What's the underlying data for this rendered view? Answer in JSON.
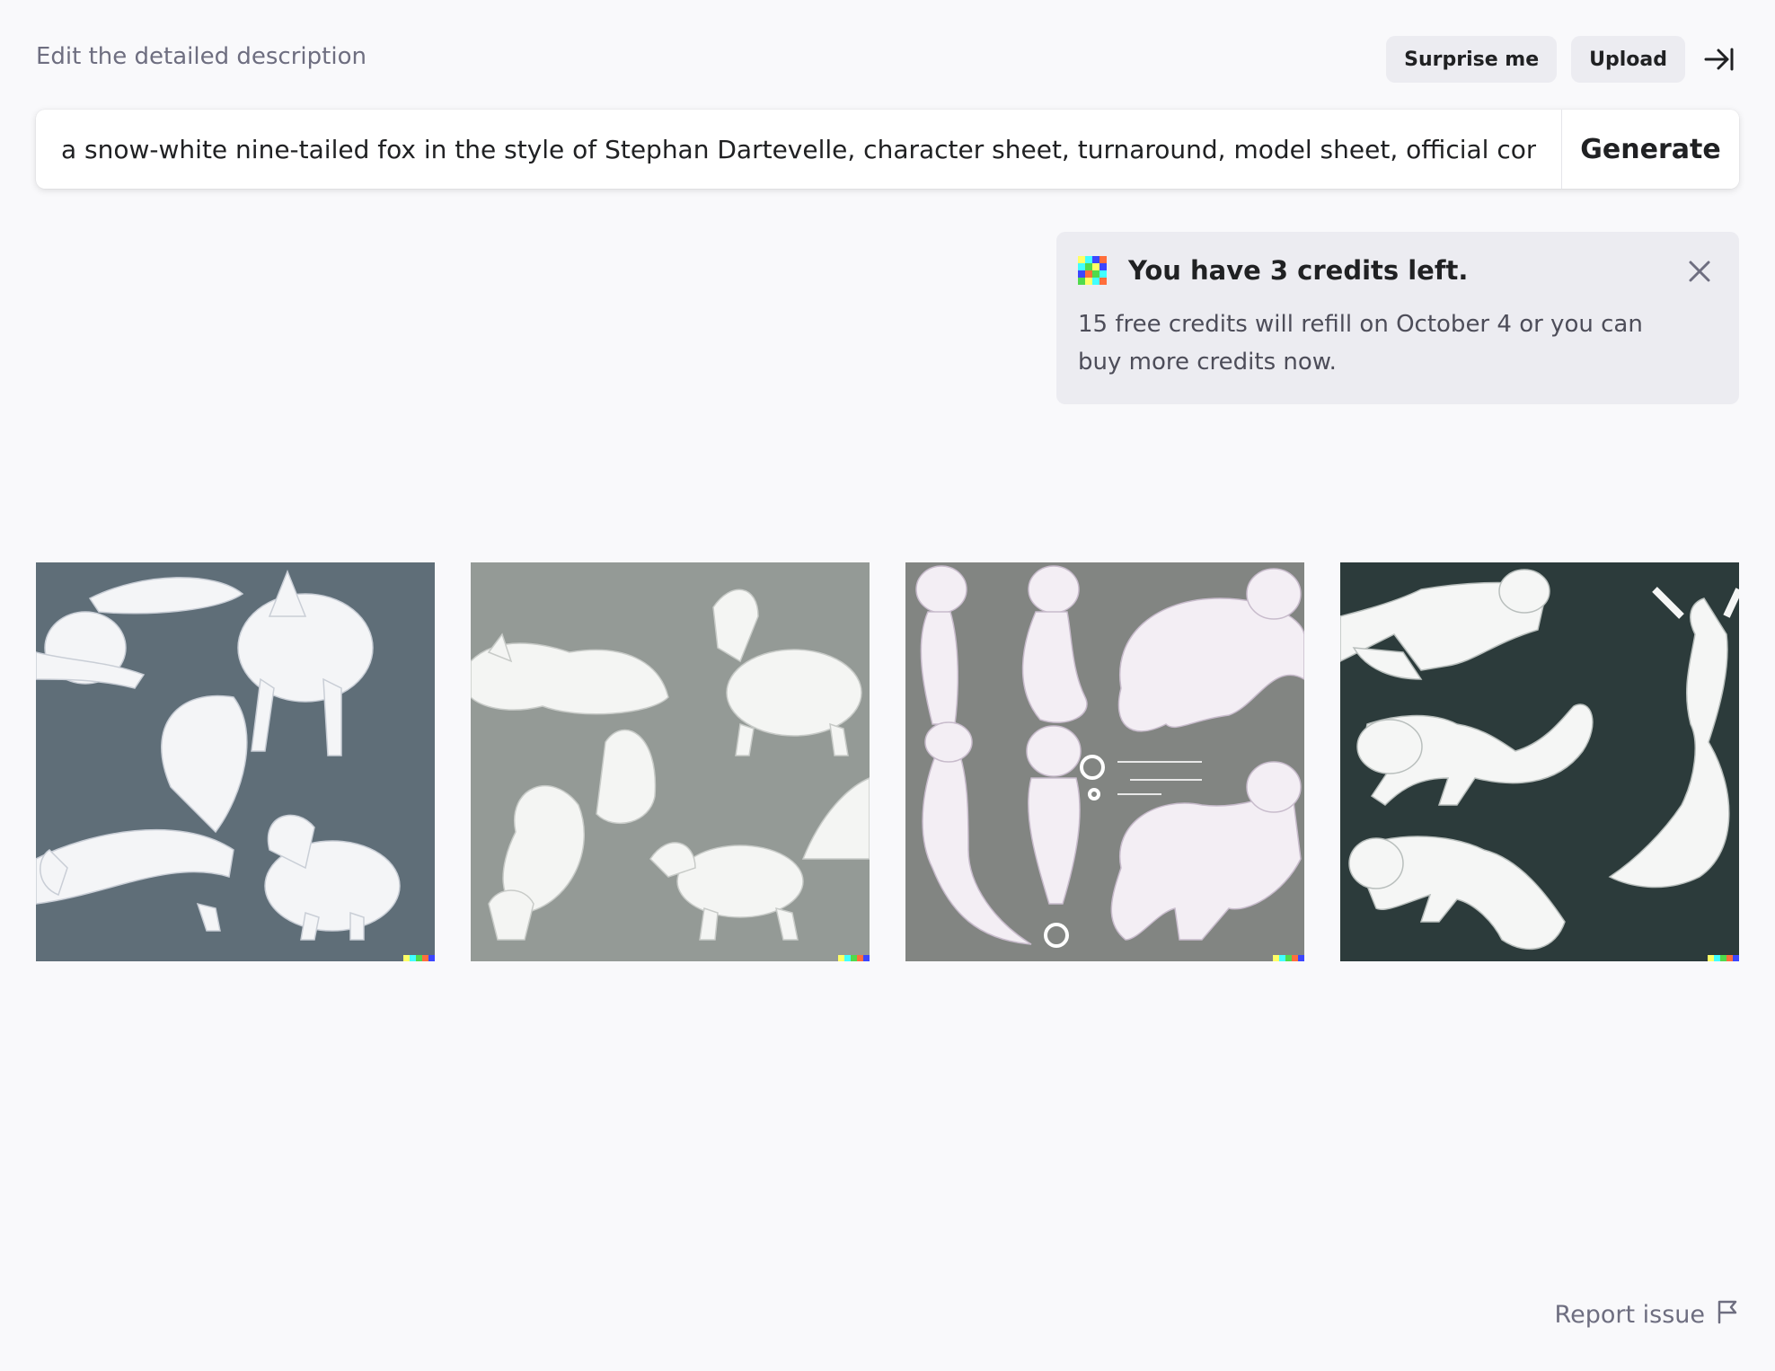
{
  "header": {
    "instruction": "Edit the detailed description",
    "surprise_label": "Surprise me",
    "upload_label": "Upload",
    "collapse_icon": "collapse-right-icon"
  },
  "prompt": {
    "value": "a snow-white nine-tailed fox in the style of Stephan Dartevelle, character sheet, turnaround, model sheet, official conce",
    "generate_label": "Generate"
  },
  "credits_banner": {
    "title": "You have 3 credits left.",
    "body": "15 free credits will refill on October 4 or you can buy more credits now.",
    "logo_colors": [
      "#ffff66",
      "#42ffff",
      "#51da4c",
      "#ff6e3c",
      "#3c46ff"
    ],
    "close_icon": "close-icon"
  },
  "gallery": {
    "images": [
      {
        "background": "#5f6e78",
        "subject": "white fox poses"
      },
      {
        "background": "#949a96",
        "subject": "white fox poses"
      },
      {
        "background": "#828582",
        "subject": "white fox poses"
      },
      {
        "background": "#2c3b3b",
        "subject": "white fox poses"
      }
    ],
    "watermark_colors": [
      "#ffff66",
      "#42ffff",
      "#51da4c",
      "#ff6e3c",
      "#3c46ff"
    ]
  },
  "footer": {
    "report_label": "Report issue",
    "report_icon": "flag-icon"
  }
}
